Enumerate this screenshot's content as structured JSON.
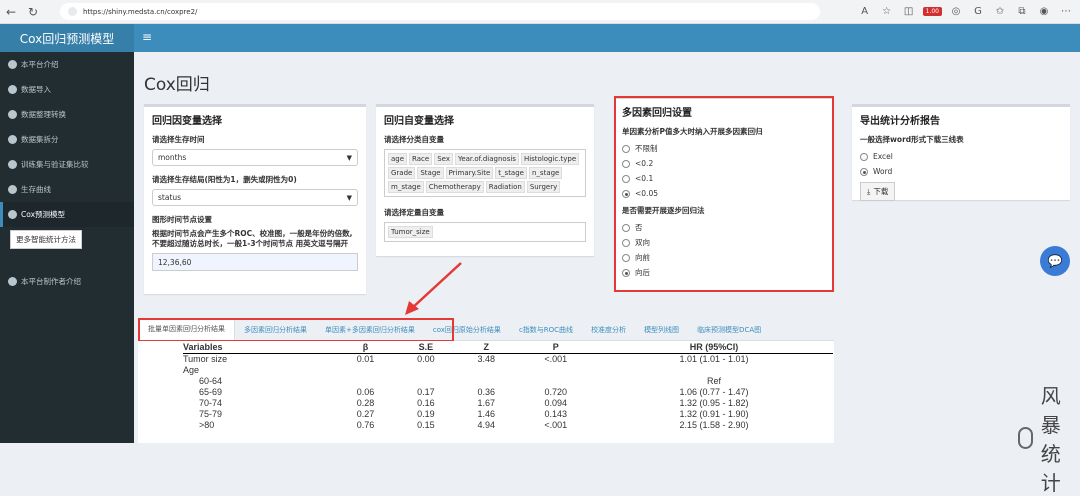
{
  "browser": {
    "url": "https://shiny.medsta.cn/coxpre2/",
    "badge": "1.00"
  },
  "app": {
    "title": "Cox回归预测模型"
  },
  "sidebar": {
    "items": [
      {
        "label": "本平台介绍"
      },
      {
        "label": "数据导入"
      },
      {
        "label": "数据整理转换"
      },
      {
        "label": "数据集拆分"
      },
      {
        "label": "训练集与验证集比较"
      },
      {
        "label": "生存曲线"
      },
      {
        "label": "Cox预测模型"
      }
    ],
    "tooltip": "更多智能统计方法",
    "bottom": "本平台制作者介绍"
  },
  "page": {
    "title": "Cox回归"
  },
  "dep_box": {
    "title": "回归因变量选择",
    "time_label": "请选择生存时间",
    "time_value": "months",
    "status_label": "请选择生存结局(阳性为1，删失或阴性为0)",
    "status_value": "status",
    "plot_label": "图形时间节点设置",
    "plot_desc": "根据时间节点会产生多个ROC、校准图，一般是年份的倍数,不要超过随访总时长，一般1-3个时间节点 用英文逗号隔开",
    "nodes_value": "12,36,60"
  },
  "indep_box": {
    "title": "回归自变量选择",
    "cat_label": "请选择分类自变量",
    "cat_tags": [
      "age",
      "Race",
      "Sex",
      "Year.of.diagnosis",
      "Histologic.type",
      "Grade",
      "Stage",
      "Primary.Site",
      "t_stage",
      "n_stage",
      "m_stage",
      "Chemotherapy",
      "Radiation",
      "Surgery"
    ],
    "cont_label": "请选择定量自变量",
    "cont_tags": [
      "Tumor_size"
    ]
  },
  "multi_box": {
    "title": "多因素回归设置",
    "p_label": "单因素分析P值多大时纳入开展多因素回归",
    "p_options": [
      {
        "label": "不限制",
        "selected": false
      },
      {
        "label": "<0.2",
        "selected": false
      },
      {
        "label": "<0.1",
        "selected": false
      },
      {
        "label": "<0.05",
        "selected": true
      }
    ],
    "step_label": "是否需要开展逐步回归法",
    "step_options": [
      {
        "label": "否",
        "selected": false
      },
      {
        "label": "双向",
        "selected": false
      },
      {
        "label": "向前",
        "selected": false
      },
      {
        "label": "向后",
        "selected": true
      }
    ]
  },
  "export_box": {
    "title": "导出统计分析报告",
    "format_label": "一般选择word形式下载三线表",
    "formats": [
      {
        "label": "Excel",
        "selected": false
      },
      {
        "label": "Word",
        "selected": true
      }
    ],
    "download": "下载"
  },
  "tabs": [
    {
      "label": "批量单因素回归分析结果",
      "active": true
    },
    {
      "label": "多因素回归分析结果",
      "active": false
    },
    {
      "label": "单因素+多因素回归分析结果",
      "active": false
    },
    {
      "label": "cox回归原始分析结果",
      "active": false
    },
    {
      "label": "c指数与ROC曲线",
      "active": false
    },
    {
      "label": "校准度分析",
      "active": false
    },
    {
      "label": "模型列线图",
      "active": false
    },
    {
      "label": "临床预测模型DCA图",
      "active": false
    }
  ],
  "table": {
    "headers": [
      "Variables",
      "β",
      "S.E",
      "Z",
      "P",
      "HR (95%CI)"
    ],
    "rows": [
      [
        "Tumor size",
        "0.01",
        "0.00",
        "3.48",
        "<.001",
        "1.01 (1.01 - 1.01)"
      ],
      [
        "Age",
        "",
        "",
        "",
        "",
        ""
      ],
      [
        "60-64",
        "",
        "",
        "",
        "",
        "Ref"
      ],
      [
        "65-69",
        "0.06",
        "0.17",
        "0.36",
        "0.720",
        "1.06 (0.77 - 1.47)"
      ],
      [
        "70-74",
        "0.28",
        "0.16",
        "1.67",
        "0.094",
        "1.32 (0.95 - 1.82)"
      ],
      [
        "75-79",
        "0.27",
        "0.19",
        "1.46",
        "0.143",
        "1.32 (0.91 - 1.90)"
      ],
      [
        ">80",
        "0.76",
        "0.15",
        "4.94",
        "<.001",
        "2.15 (1.58 - 2.90)"
      ]
    ]
  },
  "watermark": "风暴统计"
}
